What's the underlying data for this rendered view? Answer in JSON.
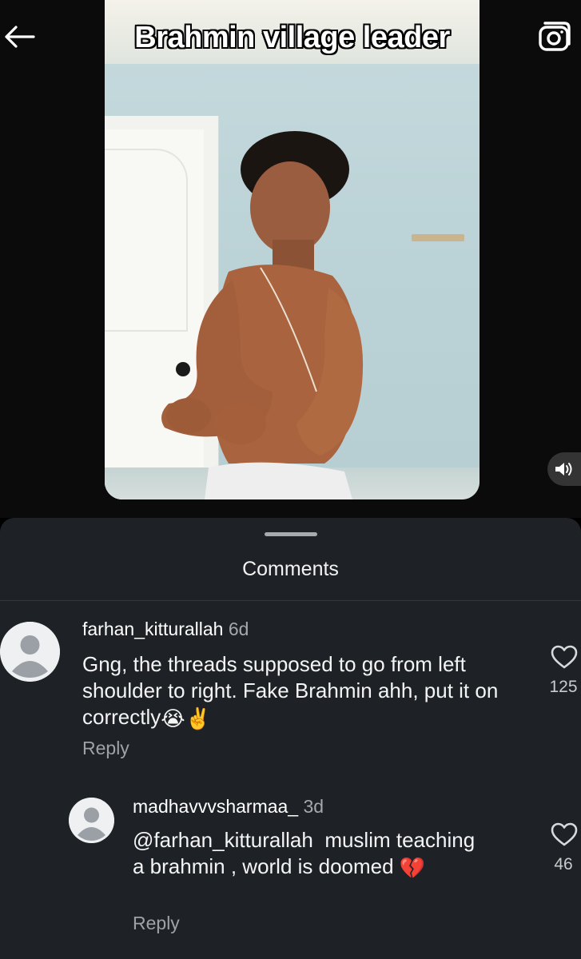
{
  "video": {
    "title": "Brahmin village leader"
  },
  "comments_sheet": {
    "title": "Comments",
    "comments": [
      {
        "username": "farhan_kitturallah",
        "time": "6d",
        "text": "Gng, the threads supposed to go from left shoulder to right. Fake Brahmin ahh, put it on correctly",
        "emojis": "😭✌️",
        "reply_label": "Reply",
        "likes": "125"
      },
      {
        "username": "madhavvvsharmaa_",
        "time": "3d",
        "mention": "@farhan_kitturallah",
        "text": "muslim teaching a brahmin , world is doomed",
        "emojis": "💔",
        "reply_label": "Reply",
        "likes": "46"
      }
    ]
  },
  "icons": {
    "back": "back-arrow-icon",
    "camera": "camera-icon",
    "sound": "speaker-icon",
    "like": "heart-icon"
  },
  "colors": {
    "sheet_bg": "#1e2226",
    "muted_text": "#a6a9ac",
    "page_bg": "#000000"
  }
}
